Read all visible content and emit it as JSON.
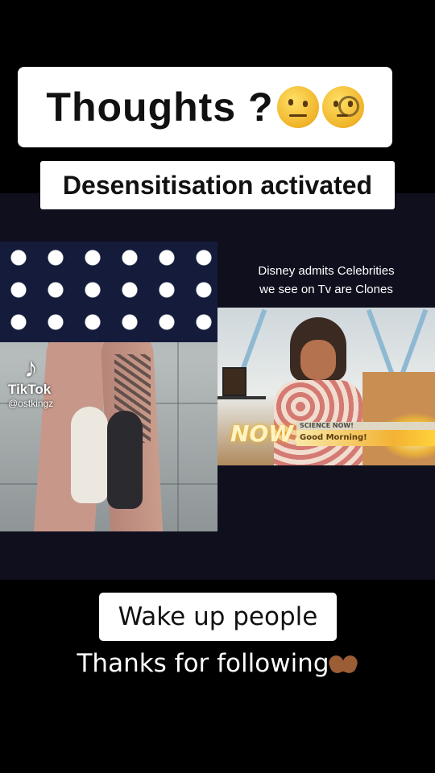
{
  "overlay": {
    "title": "Thoughts ?",
    "title_emojis": [
      "face-with-raised-eyebrow-emoji",
      "face-with-monocle-emoji"
    ],
    "subtitle": "Desensitisation activated",
    "bottom_caption": "Wake up people",
    "thanks": "Thanks for following",
    "thanks_emoji": "heart-hands-emoji"
  },
  "left_video": {
    "watermark_brand": "TikTok",
    "watermark_handle": "@ostkingz"
  },
  "right_video": {
    "caption_line1": "Disney admits Celebrities",
    "caption_line2": "we see on Tv are Clones",
    "show_logo": "NOW!",
    "lower_third_label": "SCIENCE NOW!",
    "lower_third_text": "Good Morning!"
  },
  "colors": {
    "background": "#000000",
    "panel": "#0f0f1e",
    "caption_box": "#ffffff"
  }
}
